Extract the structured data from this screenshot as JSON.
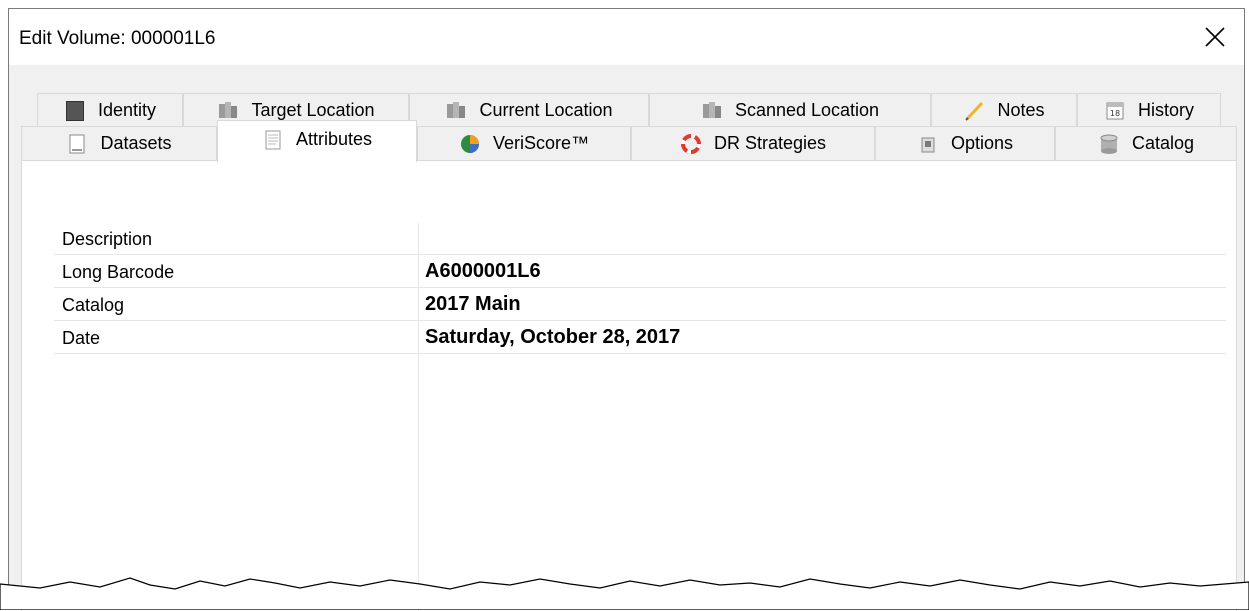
{
  "window": {
    "title": "Edit Volume: 000001L6"
  },
  "tabs_back_row": [
    {
      "label": "Identity",
      "icon": "identity-icon"
    },
    {
      "label": "Target Location",
      "icon": "target-location-icon"
    },
    {
      "label": "Current Location",
      "icon": "current-location-icon"
    },
    {
      "label": "Scanned Location",
      "icon": "scanned-location-icon"
    },
    {
      "label": "Notes",
      "icon": "pencil-icon"
    },
    {
      "label": "History",
      "icon": "calendar-icon"
    }
  ],
  "tabs_front_row": [
    {
      "label": "Datasets",
      "icon": "dataset-icon"
    },
    {
      "label": "Attributes",
      "icon": "document-icon",
      "active": true
    },
    {
      "label": "VeriScore™",
      "icon": "veriscore-icon"
    },
    {
      "label": "DR Strategies",
      "icon": "lifebuoy-icon"
    },
    {
      "label": "Options",
      "icon": "options-icon"
    },
    {
      "label": "Catalog",
      "icon": "database-icon"
    }
  ],
  "attributes": [
    {
      "label": "Description",
      "value": ""
    },
    {
      "label": "Long Barcode",
      "value": "A6000001L6"
    },
    {
      "label": "Catalog",
      "value": "2017 Main"
    },
    {
      "label": "Date",
      "value": "Saturday, October 28, 2017"
    }
  ],
  "colors": {
    "window_bg": "#f0f0f0",
    "panel_bg": "#ffffff",
    "border": "#d9d9d9",
    "grid_line": "#e6e6e6"
  }
}
